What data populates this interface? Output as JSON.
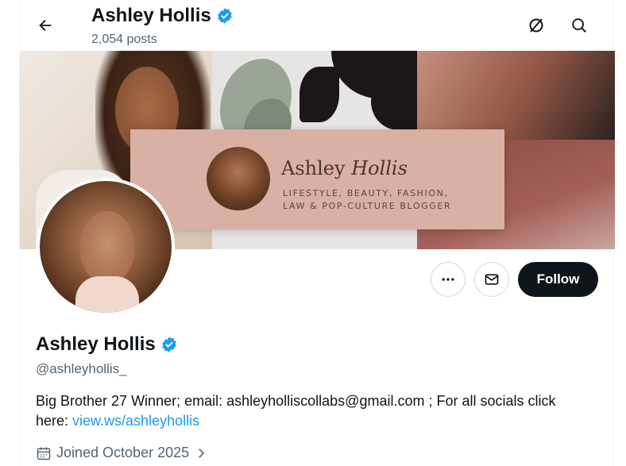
{
  "header": {
    "name": "Ashley Hollis",
    "posts": "2,054 posts"
  },
  "banner": {
    "card_name_first": "Ashley",
    "card_name_script": "Hollis",
    "card_line1": "LIFESTYLE, BEAUTY, FASHION,",
    "card_line2": "LAW & POP-CULTURE BLOGGER"
  },
  "profile": {
    "name": "Ashley Hollis",
    "handle": "@ashleyhollis_",
    "bio_text": "Big Brother 27 Winner; email: ashleyholliscollabs@gmail.com ; For all socials click here: ",
    "bio_link": "view.ws/ashleyhollis",
    "joined": "Joined October 2025"
  },
  "actions": {
    "follow_label": "Follow"
  },
  "icons": {
    "back": "arrow-left-icon",
    "grok": "grok-icon",
    "search": "search-icon",
    "more": "more-icon",
    "message": "mail-icon",
    "verified": "verified-badge-icon",
    "calendar": "calendar-icon",
    "chevron": "chevron-right-icon"
  },
  "colors": {
    "accent": "#1d9bf0",
    "text": "#0f1419",
    "secondary": "#536471",
    "follow_bg": "#0f1419"
  }
}
